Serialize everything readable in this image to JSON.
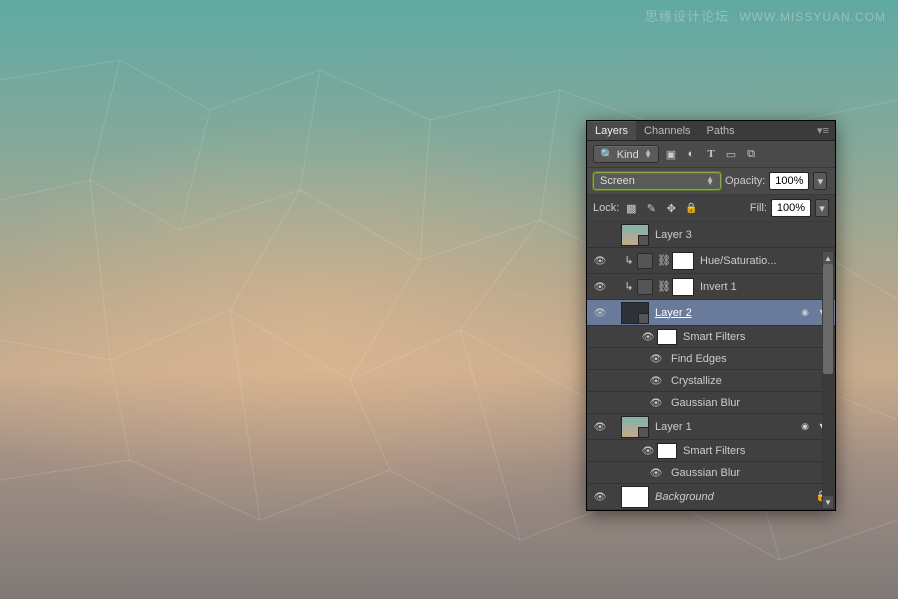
{
  "watermark": {
    "cn": "思缘设计论坛",
    "url": "WWW.MISSYUAN.COM"
  },
  "tabs": {
    "layers": "Layers",
    "channels": "Channels",
    "paths": "Paths"
  },
  "filter_row": {
    "kind": "Kind",
    "icons": [
      "image",
      "fx",
      "T",
      "shape",
      "smart"
    ]
  },
  "blend_row": {
    "mode": "Screen",
    "opacity_label": "Opacity:",
    "opacity_value": "100%"
  },
  "lock_row": {
    "lock_label": "Lock:",
    "fill_label": "Fill:",
    "fill_value": "100%"
  },
  "layers": {
    "l0": {
      "name": "Layer 3"
    },
    "l1": {
      "name": "Hue/Saturatio..."
    },
    "l2": {
      "name": "Invert 1"
    },
    "l3": {
      "name": "Layer 2"
    },
    "l3_sf": "Smart Filters",
    "l3_f1": "Find Edges",
    "l3_f2": "Crystallize",
    "l3_f3": "Gaussian Blur",
    "l4": {
      "name": "Layer 1"
    },
    "l4_sf": "Smart Filters",
    "l4_f1": "Gaussian Blur",
    "l5": {
      "name": "Background"
    }
  }
}
